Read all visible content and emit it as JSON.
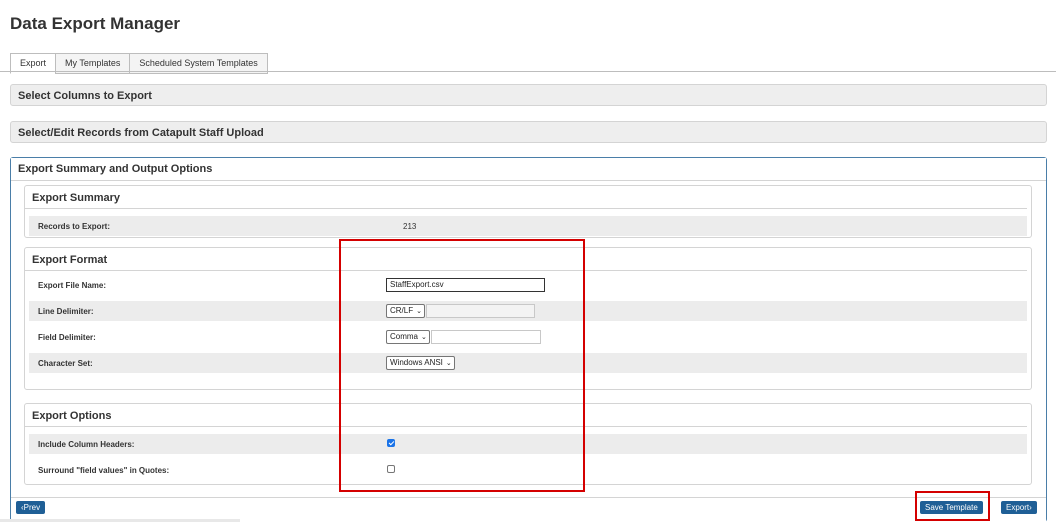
{
  "page": {
    "title": "Data Export Manager"
  },
  "tabs": [
    {
      "label": "Export",
      "active": true
    },
    {
      "label": "My Templates",
      "active": false
    },
    {
      "label": "Scheduled System Templates",
      "active": false
    }
  ],
  "panels": {
    "select_columns": "Select Columns to Export",
    "select_records": "Select/Edit Records from Catapult Staff Upload",
    "summary_output": "Export Summary and Output Options"
  },
  "export_summary": {
    "title": "Export Summary",
    "records_label": "Records to Export:",
    "records_value": "213"
  },
  "export_format": {
    "title": "Export Format",
    "file_name_label": "Export File Name:",
    "file_name_value": "StaffExport.csv",
    "line_delim_label": "Line Delimiter:",
    "line_delim_value": "CR/LF",
    "field_delim_label": "Field Delimiter:",
    "field_delim_value": "Comma",
    "charset_label": "Character Set:",
    "charset_value": "Windows ANSI"
  },
  "export_options": {
    "title": "Export Options",
    "include_headers_label": "Include Column Headers:",
    "include_headers_checked": true,
    "quotes_label": "Surround \"field values\" in Quotes:",
    "quotes_checked": false
  },
  "footer": {
    "prev_label": "Prev",
    "save_template_label": "Save Template",
    "export_label": "Export"
  },
  "colors": {
    "button": "#1f5f96",
    "highlight": "#d40000",
    "panel_border": "#4a7ea8"
  }
}
